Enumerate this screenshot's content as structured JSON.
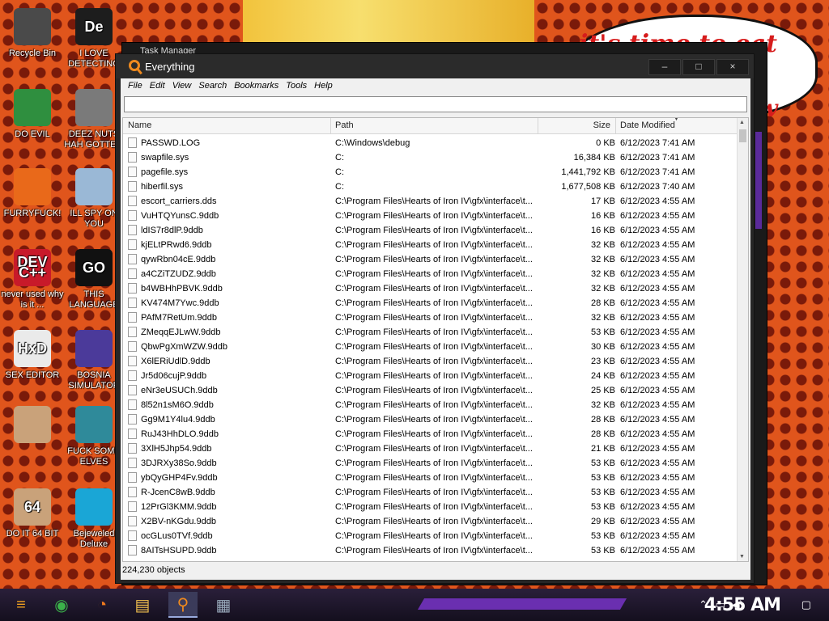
{
  "wallpaper": {
    "speech_text_1": "it's time to eat shit",
    "speech_text_2": "w"
  },
  "desktop_icons": [
    {
      "label": "Recycle Bin",
      "icon": "recycle-bin-icon",
      "color": "#4a4a4a"
    },
    {
      "label": "I LOVE DETECTING",
      "icon": "de-logo-icon",
      "color": "#1d1d1d",
      "glyph": "De"
    },
    {
      "label": "DO EVIL",
      "icon": "chrome-icon",
      "color": "#2f8f3f"
    },
    {
      "label": "DEEZ NUTS HAH GOTTEM",
      "icon": "stack-windows-icon",
      "color": "#7a7a7a"
    },
    {
      "label": "FURRYFUCK!",
      "icon": "firefox-icon",
      "color": "#e9691a"
    },
    {
      "label": "ILL SPY ON YOU",
      "icon": "network-spy-icon",
      "color": "#9ab8d6"
    },
    {
      "label": "never used why is it ...",
      "icon": "devcpp-icon",
      "color": "#c81a2a",
      "glyph": "DEV C++"
    },
    {
      "label": "THIS LANGUAGE",
      "icon": "goland-icon",
      "color": "#111",
      "glyph": "GO"
    },
    {
      "label": "SEX EDITOR",
      "icon": "hxd-icon",
      "color": "#eaeaea",
      "glyph": "HxD"
    },
    {
      "label": "BOSNIA SIMULATOR",
      "icon": "mine-ball-icon",
      "color": "#4b3a9a"
    },
    {
      "label": "",
      "icon": "portrait-icon",
      "color": "#c9a27a"
    },
    {
      "label": "FUCK SOME ELVES",
      "icon": "elf-icon",
      "color": "#2f8a9a"
    },
    {
      "label": "DO IT 64 BIT",
      "icon": "portrait-64-icon",
      "color": "#c9a27a",
      "glyph": "64"
    },
    {
      "label": "Bejeweled Deluxe",
      "icon": "diamond-icon",
      "color": "#1aa6d6"
    }
  ],
  "task_manager": {
    "title": "Task Manager"
  },
  "window": {
    "title": "Everything",
    "minimize": "–",
    "maximize": "□",
    "close": "×",
    "menu": [
      "File",
      "Edit",
      "View",
      "Search",
      "Bookmarks",
      "Tools",
      "Help"
    ],
    "search_value": "",
    "columns": {
      "name": "Name",
      "path": "Path",
      "size": "Size",
      "date": "Date Modified"
    },
    "status": "224,230 objects"
  },
  "files": [
    {
      "name": "PASSWD.LOG",
      "path": "C:\\Windows\\debug",
      "size": "0 KB",
      "date": "6/12/2023 7:41 AM"
    },
    {
      "name": "swapfile.sys",
      "path": "C:",
      "size": "16,384 KB",
      "date": "6/12/2023 7:41 AM"
    },
    {
      "name": "pagefile.sys",
      "path": "C:",
      "size": "1,441,792 KB",
      "date": "6/12/2023 7:41 AM"
    },
    {
      "name": "hiberfil.sys",
      "path": "C:",
      "size": "1,677,508 KB",
      "date": "6/12/2023 7:40 AM"
    },
    {
      "name": "escort_carriers.dds",
      "path": "C:\\Program Files\\Hearts of Iron IV\\gfx\\interface\\t...",
      "size": "17 KB",
      "date": "6/12/2023 4:55 AM"
    },
    {
      "name": "VuHTQYunsC.9ddb",
      "path": "C:\\Program Files\\Hearts of Iron IV\\gfx\\interface\\t...",
      "size": "16 KB",
      "date": "6/12/2023 4:55 AM"
    },
    {
      "name": "ldIS7r8dlP.9ddb",
      "path": "C:\\Program Files\\Hearts of Iron IV\\gfx\\interface\\t...",
      "size": "16 KB",
      "date": "6/12/2023 4:55 AM"
    },
    {
      "name": "kjELtPRwd6.9ddb",
      "path": "C:\\Program Files\\Hearts of Iron IV\\gfx\\interface\\t...",
      "size": "32 KB",
      "date": "6/12/2023 4:55 AM"
    },
    {
      "name": "qywRbn04cE.9ddb",
      "path": "C:\\Program Files\\Hearts of Iron IV\\gfx\\interface\\t...",
      "size": "32 KB",
      "date": "6/12/2023 4:55 AM"
    },
    {
      "name": "a4CZiTZUDZ.9ddb",
      "path": "C:\\Program Files\\Hearts of Iron IV\\gfx\\interface\\t...",
      "size": "32 KB",
      "date": "6/12/2023 4:55 AM"
    },
    {
      "name": "b4WBHhPBVK.9ddb",
      "path": "C:\\Program Files\\Hearts of Iron IV\\gfx\\interface\\t...",
      "size": "32 KB",
      "date": "6/12/2023 4:55 AM"
    },
    {
      "name": "KV474M7Ywc.9ddb",
      "path": "C:\\Program Files\\Hearts of Iron IV\\gfx\\interface\\t...",
      "size": "28 KB",
      "date": "6/12/2023 4:55 AM"
    },
    {
      "name": "PAfM7RetUm.9ddb",
      "path": "C:\\Program Files\\Hearts of Iron IV\\gfx\\interface\\t...",
      "size": "32 KB",
      "date": "6/12/2023 4:55 AM"
    },
    {
      "name": "ZMeqqEJLwW.9ddb",
      "path": "C:\\Program Files\\Hearts of Iron IV\\gfx\\interface\\t...",
      "size": "53 KB",
      "date": "6/12/2023 4:55 AM"
    },
    {
      "name": "QbwPgXmWZW.9ddb",
      "path": "C:\\Program Files\\Hearts of Iron IV\\gfx\\interface\\t...",
      "size": "30 KB",
      "date": "6/12/2023 4:55 AM"
    },
    {
      "name": "X6lERiUdlD.9ddb",
      "path": "C:\\Program Files\\Hearts of Iron IV\\gfx\\interface\\t...",
      "size": "23 KB",
      "date": "6/12/2023 4:55 AM"
    },
    {
      "name": "Jr5d06cujP.9ddb",
      "path": "C:\\Program Files\\Hearts of Iron IV\\gfx\\interface\\t...",
      "size": "24 KB",
      "date": "6/12/2023 4:55 AM"
    },
    {
      "name": "eNr3eUSUCh.9ddb",
      "path": "C:\\Program Files\\Hearts of Iron IV\\gfx\\interface\\t...",
      "size": "25 KB",
      "date": "6/12/2023 4:55 AM"
    },
    {
      "name": "8l52n1sM6O.9ddb",
      "path": "C:\\Program Files\\Hearts of Iron IV\\gfx\\interface\\t...",
      "size": "32 KB",
      "date": "6/12/2023 4:55 AM"
    },
    {
      "name": "Gg9M1Y4lu4.9ddb",
      "path": "C:\\Program Files\\Hearts of Iron IV\\gfx\\interface\\t...",
      "size": "28 KB",
      "date": "6/12/2023 4:55 AM"
    },
    {
      "name": "RuJ43HhDLO.9ddb",
      "path": "C:\\Program Files\\Hearts of Iron IV\\gfx\\interface\\t...",
      "size": "28 KB",
      "date": "6/12/2023 4:55 AM"
    },
    {
      "name": "3XlH5Jhp54.9ddb",
      "path": "C:\\Program Files\\Hearts of Iron IV\\gfx\\interface\\t...",
      "size": "21 KB",
      "date": "6/12/2023 4:55 AM"
    },
    {
      "name": "3DJRXy38So.9ddb",
      "path": "C:\\Program Files\\Hearts of Iron IV\\gfx\\interface\\t...",
      "size": "53 KB",
      "date": "6/12/2023 4:55 AM"
    },
    {
      "name": "ybQyGHP4Fv.9ddb",
      "path": "C:\\Program Files\\Hearts of Iron IV\\gfx\\interface\\t...",
      "size": "53 KB",
      "date": "6/12/2023 4:55 AM"
    },
    {
      "name": "R-JcenC8wB.9ddb",
      "path": "C:\\Program Files\\Hearts of Iron IV\\gfx\\interface\\t...",
      "size": "53 KB",
      "date": "6/12/2023 4:55 AM"
    },
    {
      "name": "12PrGl3KMM.9ddb",
      "path": "C:\\Program Files\\Hearts of Iron IV\\gfx\\interface\\t...",
      "size": "53 KB",
      "date": "6/12/2023 4:55 AM"
    },
    {
      "name": "X2BV-nKGdu.9ddb",
      "path": "C:\\Program Files\\Hearts of Iron IV\\gfx\\interface\\t...",
      "size": "29 KB",
      "date": "6/12/2023 4:55 AM"
    },
    {
      "name": "ocGLus0TVf.9ddb",
      "path": "C:\\Program Files\\Hearts of Iron IV\\gfx\\interface\\t...",
      "size": "53 KB",
      "date": "6/12/2023 4:55 AM"
    },
    {
      "name": "8AITsHSUPD.9ddb",
      "path": "C:\\Program Files\\Hearts of Iron IV\\gfx\\interface\\t...",
      "size": "53 KB",
      "date": "6/12/2023 4:55 AM"
    }
  ],
  "taskbar": {
    "apps": [
      "start-icon",
      "chrome-icon",
      "firefox-icon",
      "file-explorer-icon",
      "everything-icon",
      "task-manager-icon"
    ],
    "clock": "4:55 AM"
  }
}
